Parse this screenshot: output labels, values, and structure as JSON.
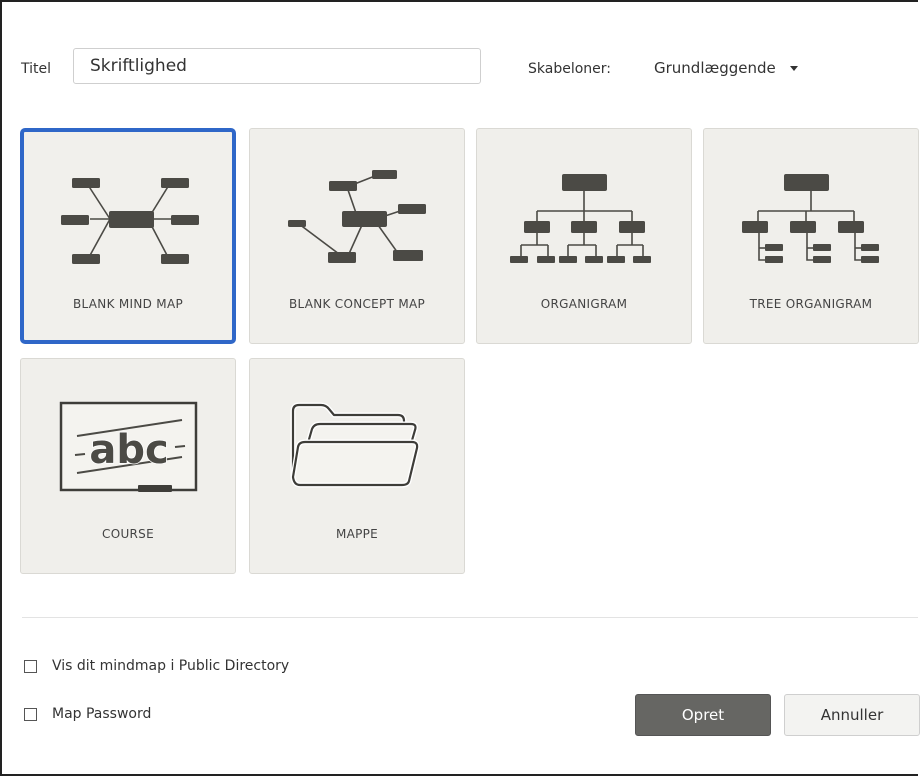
{
  "form": {
    "title_label": "Titel",
    "title_value": "Skriftlighed",
    "templates_label": "Skabeloner:",
    "templates_selected": "Grundlæggende"
  },
  "templates": [
    {
      "label": "BLANK MIND MAP",
      "icon": "mind-map-icon",
      "selected": true
    },
    {
      "label": "BLANK CONCEPT MAP",
      "icon": "concept-map-icon",
      "selected": false
    },
    {
      "label": "ORGANIGRAM",
      "icon": "organigram-icon",
      "selected": false
    },
    {
      "label": "TREE ORGANIGRAM",
      "icon": "tree-organigram-icon",
      "selected": false
    },
    {
      "label": "COURSE",
      "icon": "chalkboard-abc-icon",
      "selected": false
    },
    {
      "label": "MAPPE",
      "icon": "folder-icon",
      "selected": false
    }
  ],
  "options": {
    "public_directory_label": "Vis dit mindmap i Public Directory",
    "public_directory_checked": false,
    "password_label": "Map Password",
    "password_checked": false
  },
  "actions": {
    "create_label": "Opret",
    "cancel_label": "Annuller"
  },
  "colors": {
    "selection_border": "#2f67c8",
    "tile_background": "#f0efeb",
    "icon_fill": "#4b4a45",
    "primary_button": "#666663"
  }
}
